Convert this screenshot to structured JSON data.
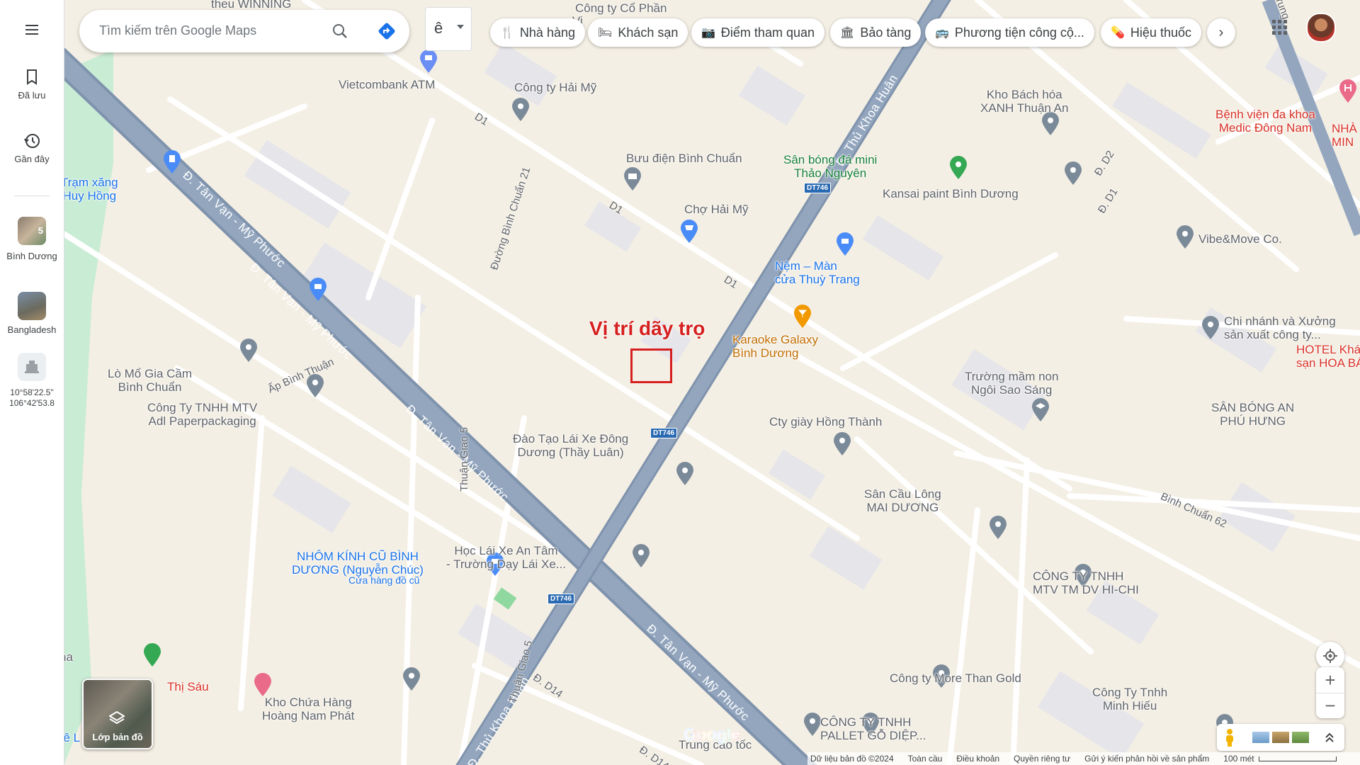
{
  "search": {
    "placeholder": "Tìm kiếm trên Google Maps"
  },
  "ime": {
    "label": "ê"
  },
  "rail": {
    "saved_label": "Đã lưu",
    "recent_label": "Gần đây",
    "binh_duong_label": "Bình Dương",
    "binh_duong_count": "5",
    "bangladesh_label": "Bangladesh",
    "coords_line1": "10°58'22.5\"",
    "coords_line2": "106°42'53.8"
  },
  "chips": [
    "Nhà hàng",
    "Khách sạn",
    "Điểm tham quan",
    "Bảo tàng",
    "Phương tiện công cộ...",
    "Hiệu thuốc"
  ],
  "chip_icons": [
    "fork-knife-icon",
    "bed-icon",
    "camera-icon",
    "museum-icon",
    "bus-icon",
    "pharmacy-icon"
  ],
  "annotation": {
    "text": "Vị trí dãy trọ",
    "color": "#d61f1f"
  },
  "places": {
    "p1": "Vietcombank ATM",
    "p2": "Công ty Hải Mỹ",
    "p3": "Công ty Cổ Phần",
    "p4": "Bưu điện Bình Chuẩn",
    "p5": "Chợ Hải Mỹ",
    "p6": "Sân bóng đá mini\nThảo Nguyên",
    "p7": "Kho Bách hóa\nXANH Thuận An",
    "p8": "Kansai paint Bình Dương",
    "p9": "Bệnh viện đa khoa\nMedic Đông Nam",
    "p10": "Nệm – Màn\ncửa Thuỳ Trang",
    "p11": "Karaoke Galaxy\nBình Dương",
    "p12": "Vibe&Move Co.",
    "p13": "Chi nhánh và Xưởng\nsản xuất công ty...",
    "p14": "HOTEL Khá\nsạn HOA BÁ",
    "p15": "Trạm xăng\nHuy Hồng",
    "p16": "Lò Mổ Gia Cầm\nBình Chuẩn",
    "p17": "Công Ty TNHH MTV\nAdl Paperpackaging",
    "p18": "Trường mầm non\nNgôi Sao Sáng",
    "p19": "Cty giày Hồng Thành",
    "p20": "SÂN BÓNG AN\nPHÚ HƯNG",
    "p21": "Đào Tạo Lái Xe Đông\nDương (Thầy Luân)",
    "p22": "Sân Cầu Lông\nMAI DƯƠNG",
    "p23": "NHÔM KÍNH CŨ BÌNH\nDƯƠNG (Nguyễn Chúc)",
    "p23b": "Cửa hàng đồ cũ",
    "p24": "Học Lái Xe An Tâm\n- Trường Dạy Lái Xe...",
    "p25": "CÔNG TY TNHH\nMTV TM DV HI-CHI",
    "p26": "Thị Sáu",
    "p27": "Kho Chứa Hàng\nHoàng Nam Phát",
    "p28": "Công ty More Than Gold",
    "p29": "Công Ty Tnhh\nMinh Hiếu",
    "p30": "CÔNG TY TNHH\nPALLET GỖ DIỆP...",
    "p31": "Trung cao tốc",
    "p32": "NHÀ\nMIN",
    "p33": "Lê L",
    "p34": "ha",
    "p35": "theu WINNING",
    "p36": "Vi"
  },
  "roads": {
    "tanvan": "Đ. Tân Vạn - Mỹ Phước",
    "thukhoahuan": "Đ. Thủ Khoa Huân",
    "d1": "D1",
    "d2": "Đ. D2",
    "dd1": "Đ. D1",
    "bc21": "Đường Bình Chuẩn 21",
    "apbinhthuan": "Ấp Bình Thuận",
    "thuangiao5": "Thuận Giao 5",
    "binhchuan62": "Bình Chuẩn 62",
    "d14": "Đ. D14",
    "d14b": "Đ. D14",
    "dt746": "DT746",
    "trung": "Trung"
  },
  "layers": {
    "label": "Lớp bản đồ"
  },
  "google_logo": "Google",
  "footer": {
    "items": [
      "Dữ liệu bản đồ ©2024",
      "Toàn cầu",
      "Điều khoản",
      "Quyền riêng tư",
      "Gửi ý kiến phản hồi về sản phẩm"
    ],
    "scale": "100 mét"
  },
  "colors": {
    "road_major": "#8fa1b9",
    "road_minor": "#ffffff",
    "land": "#f4efe4",
    "building": "#e6e6ea",
    "green": "#c9ecd5",
    "accent_red": "#d61f1f",
    "pin_gray": "#7b8a99",
    "pin_blue": "#4a8cf7",
    "pin_green": "#34a853",
    "pin_orange": "#f29900",
    "pin_pink": "#ea6a8a"
  }
}
